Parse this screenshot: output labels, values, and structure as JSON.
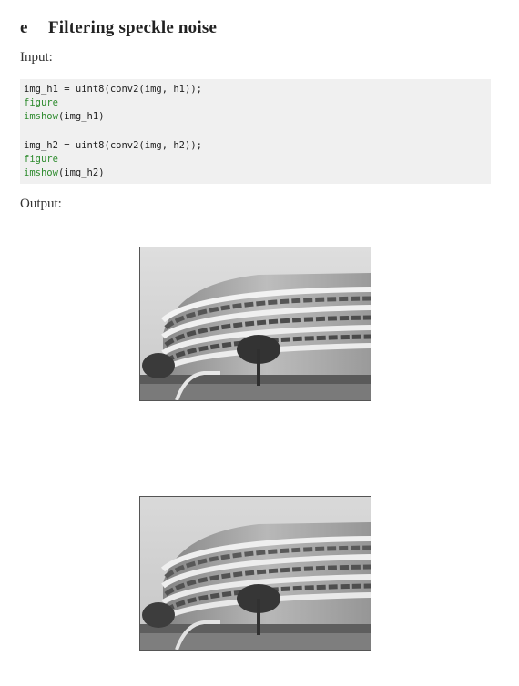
{
  "heading": {
    "letter": "e",
    "title": "Filtering speckle noise"
  },
  "input_label": "Input:",
  "code": {
    "block1": {
      "line1": "img_h1 = uint8(conv2(img, h1));",
      "line2": "figure",
      "line3_fn": "imshow",
      "line3_arg": "(img_h1)"
    },
    "block2": {
      "line1": "img_h2 = uint8(conv2(img, h2));",
      "line2": "figure",
      "line3_fn": "imshow",
      "line3_arg": "(img_h2)"
    },
    "keyword_color": "#2e8b2e"
  },
  "output_label": "Output:",
  "figures": [
    {
      "icon": "building-photo-filtered-h1"
    },
    {
      "icon": "building-photo-filtered-h2"
    }
  ]
}
